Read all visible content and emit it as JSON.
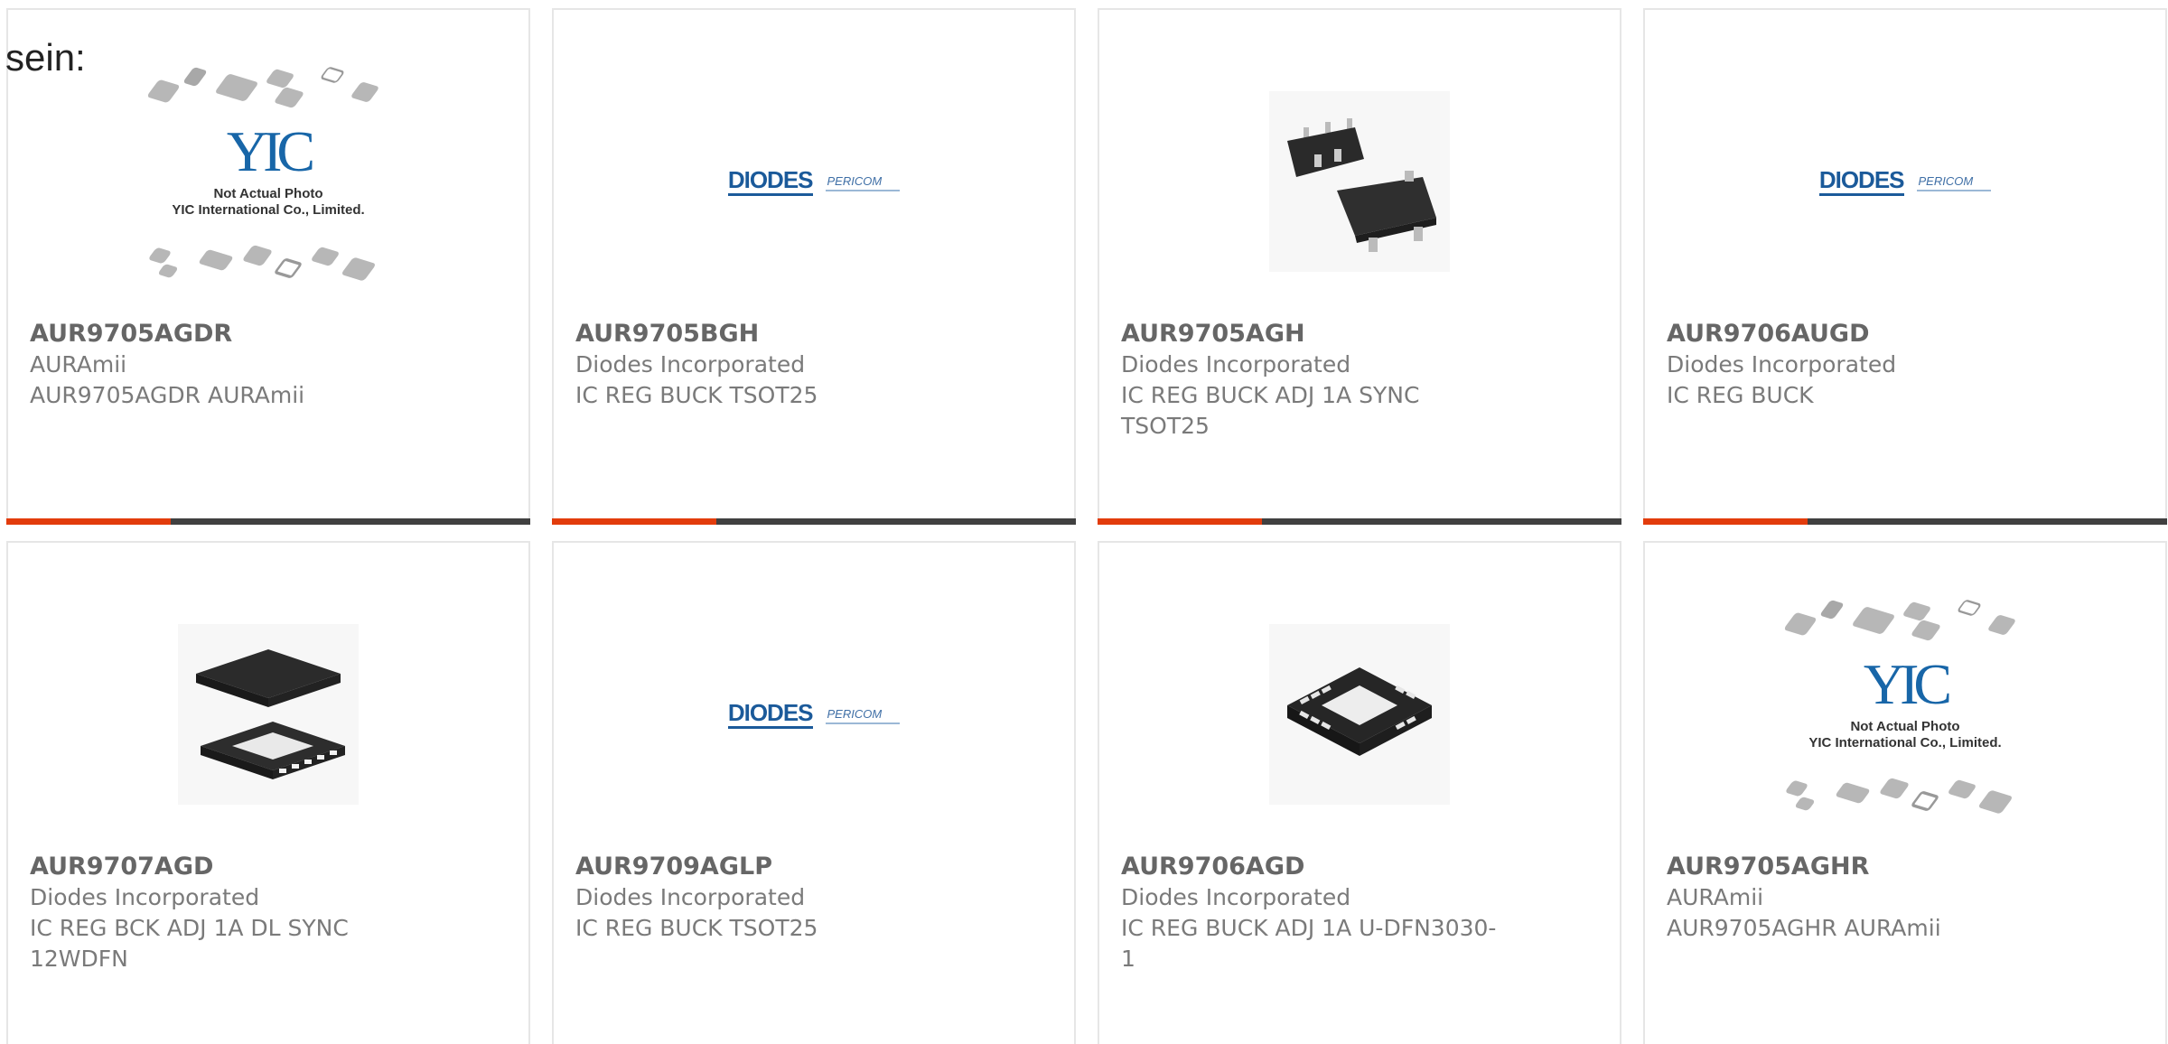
{
  "intro_text": "sein:",
  "accent_color": "#e23c0c",
  "bar_color": "#404040",
  "products": [
    {
      "part": "AUR9705AGDR",
      "manufacturer": "AURAmii",
      "description": "AUR9705AGDR AURAmii",
      "image": "yic-placeholder",
      "image_note_1": "Not Actual Photo",
      "image_note_2": "YIC International Co., Limited."
    },
    {
      "part": "AUR9705BGH",
      "manufacturer": "Diodes Incorporated",
      "description": "IC REG BUCK TSOT25",
      "image": "diodes-logo",
      "logo_text": "DIODES",
      "logo_sub": "PERICOM"
    },
    {
      "part": "AUR9705AGH",
      "manufacturer": "Diodes Incorporated",
      "description": "IC REG BUCK ADJ 1A SYNC TSOT25",
      "image": "tsot25-package"
    },
    {
      "part": "AUR9706AUGD",
      "manufacturer": "Diodes Incorporated",
      "description": "IC REG BUCK",
      "image": "diodes-logo",
      "logo_text": "DIODES",
      "logo_sub": "PERICOM"
    },
    {
      "part": "AUR9707AGD",
      "manufacturer": "Diodes Incorporated",
      "description": "IC REG BCK ADJ 1A DL SYNC 12WDFN",
      "image": "wdfn-package"
    },
    {
      "part": "AUR9709AGLP",
      "manufacturer": "Diodes Incorporated",
      "description": "IC REG BUCK TSOT25",
      "image": "diodes-logo",
      "logo_text": "DIODES",
      "logo_sub": "PERICOM"
    },
    {
      "part": "AUR9706AGD",
      "manufacturer": "Diodes Incorporated",
      "description": "IC REG BUCK ADJ 1A U-DFN3030-1",
      "image": "dfn-package"
    },
    {
      "part": "AUR9705AGHR",
      "manufacturer": "AURAmii",
      "description": "AUR9705AGHR AURAmii",
      "image": "yic-placeholder",
      "image_note_1": "Not Actual Photo",
      "image_note_2": "YIC International Co., Limited."
    }
  ]
}
